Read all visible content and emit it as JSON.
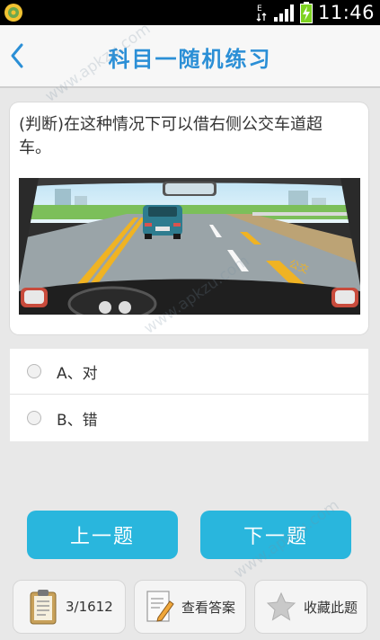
{
  "status_bar": {
    "time": "11:46",
    "network": "E"
  },
  "header": {
    "title": "科目一随机练习"
  },
  "question": {
    "text": "(判断)在这种情况下可以借右侧公交车道超车。"
  },
  "options": [
    {
      "label": "A、对"
    },
    {
      "label": "B、错"
    }
  ],
  "nav_buttons": {
    "prev": "上一题",
    "next": "下一题"
  },
  "toolbar": {
    "progress": "3/1612",
    "answer": "查看答案",
    "favorite": "收藏此题"
  },
  "watermarks": [
    "www.apkzu.com",
    "www.apkzu.com",
    "www.apkzu.com"
  ],
  "colors": {
    "accent": "#2b8fd6",
    "button": "#29b6dd"
  }
}
